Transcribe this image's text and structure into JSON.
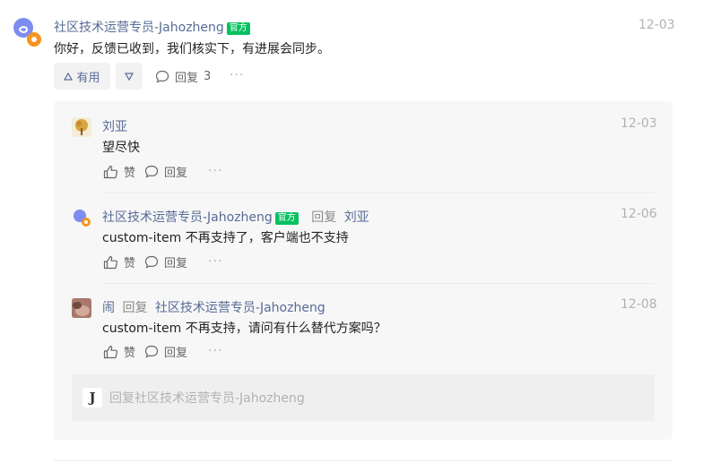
{
  "main_comment": {
    "author": "社区技术运营专员-Jahozheng",
    "badge": "官方",
    "date": "12-03",
    "text": "你好，反馈已收到，我们核实下，有进展会同步。",
    "useful_label": "有用",
    "reply_label": "回复",
    "reply_count": "3",
    "more": "···"
  },
  "replies": [
    {
      "author": "刘亚",
      "date": "12-03",
      "text": "望尽快",
      "like_label": "赞",
      "reply_label": "回复",
      "more": "···"
    },
    {
      "author": "社区技术运营专员-Jahozheng",
      "badge": "官方",
      "reply_word": "回复",
      "reply_to": "刘亚",
      "date": "12-06",
      "text": "custom-item 不再支持了，客户端也不支持",
      "like_label": "赞",
      "reply_label": "回复",
      "more": "···"
    },
    {
      "author": "闹",
      "reply_word": "回复",
      "reply_to": "社区技术运营专员-Jahozheng",
      "date": "12-08",
      "text": "custom-item 不再支持，请问有什么替代方案吗？",
      "like_label": "赞",
      "reply_label": "回复",
      "more": "···"
    }
  ],
  "reply_input": {
    "avatar_letter": "J",
    "placeholder": "回复社区技术运营专员-Jahozheng"
  },
  "colors": {
    "name": "#576b95",
    "badge": "#07c160",
    "date": "#b2b2b2",
    "panel": "#f7f7f7"
  }
}
